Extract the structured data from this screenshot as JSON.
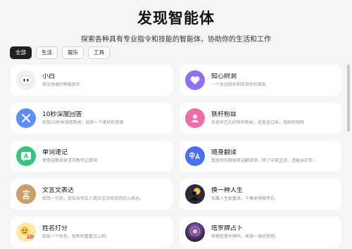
{
  "header": {
    "title": "发现智能体",
    "subtitle": "探索各种具有专业指令和技能的智能体，协助你的生活和工作"
  },
  "tabs": [
    {
      "label": "全部"
    },
    {
      "label": "生活"
    },
    {
      "label": "娱乐"
    },
    {
      "label": "工具"
    }
  ],
  "agents": [
    {
      "name": "小白",
      "desc": "简洁快速的帮能助手",
      "icon": "robot-face-icon",
      "color": "#eef0f2"
    },
    {
      "name": "知心树洞",
      "desc": "一个永远陪伴和支持你的朋友",
      "icon": "heart-icon",
      "color": "#8e6ff0"
    },
    {
      "name": "10秒深度回答",
      "desc": "给我10秒钟深思熟虑，给你一个更好的答案",
      "icon": "tools-cross-icon",
      "color": "#5b8ff7"
    },
    {
      "name": "铁杆粉丝",
      "desc": "你是你已久的铁杆粉丝，追星追过来，想和你唠唠",
      "icon": "person-icon",
      "color": "#f06ba8"
    },
    {
      "name": "单词速记",
      "desc": "使用无数奇技淫巧帮你记单词",
      "icon": "letter-a-icon",
      "color": "#34c47c"
    },
    {
      "name": "随身翻译",
      "desc": "我是你的随身英语翻译官，除了中英互译，还能纠正你...",
      "icon": "translate-icon",
      "color": "#4c6ef5"
    },
    {
      "name": "文言文表达",
      "desc": "给我一句话，我告诉你古人用文言文和诗词怎么表达。",
      "icon": "classical-text-icon",
      "color": "#c9a06a"
    },
    {
      "name": "换一种人生",
      "desc": "如果人生能重来，千嘛非得做李白",
      "icon": "silhouette-portrait-icon",
      "color": "#2d2a3a"
    },
    {
      "name": "姓名打分",
      "desc": "给我一个姓名，我帮你看看怎么样。",
      "icon": "score-100-icon",
      "color": "#f6c646"
    },
    {
      "name": "塔罗牌占卜",
      "desc": "你相信塔罗牌吗，来测一测运势吧。",
      "icon": "tarot-portrait-icon",
      "color": "#3b2a55"
    }
  ]
}
